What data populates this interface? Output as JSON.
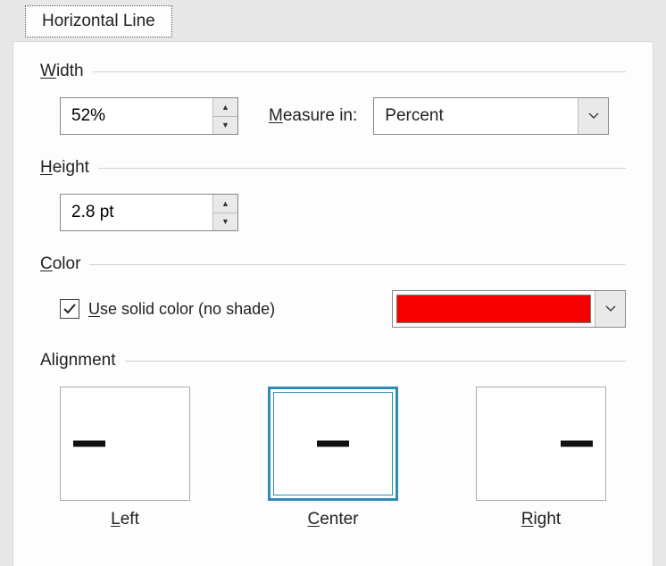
{
  "tab": {
    "label": "Horizontal Line"
  },
  "width": {
    "label_pre": "W",
    "label_und": "W",
    "label_rest": "idth",
    "value": "52%"
  },
  "measure": {
    "label_und": "M",
    "label_rest": "easure in:",
    "selected": "Percent"
  },
  "height": {
    "label_und": "H",
    "label_rest": "eight",
    "value": "2.8 pt"
  },
  "color": {
    "label_und": "C",
    "label_rest": "olor",
    "checkbox_und": "U",
    "checkbox_rest": "se solid color (no shade)",
    "checked": true,
    "swatch": "#f70000"
  },
  "alignment": {
    "label": "Alignment",
    "options": {
      "left": {
        "und": "L",
        "rest": "eft"
      },
      "center": {
        "und": "C",
        "rest": "enter"
      },
      "right": {
        "und": "R",
        "rest": "ight"
      }
    },
    "selected": "center"
  }
}
